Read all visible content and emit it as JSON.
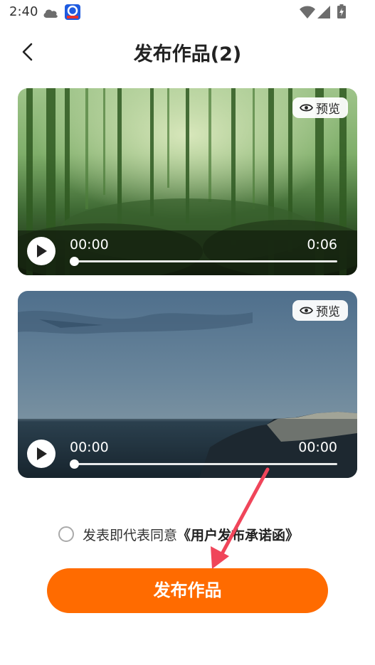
{
  "status_bar": {
    "time": "2:40",
    "icons": [
      "cloud-icon",
      "app-badge-icon",
      "wifi-icon",
      "signal-icon",
      "battery-icon"
    ]
  },
  "header": {
    "title": "发布作品(2)",
    "back_icon": "chevron-left-icon"
  },
  "videos": [
    {
      "preview_label": "预览",
      "preview_icon": "eye-icon",
      "current_time": "00:00",
      "duration": "0:06",
      "progress": 0,
      "scene": "bamboo-forest"
    },
    {
      "preview_label": "预览",
      "preview_icon": "eye-icon",
      "current_time": "00:00",
      "duration": "00:00",
      "progress": 0,
      "scene": "sea-cliffs-dusk"
    }
  ],
  "agreement": {
    "checked": false,
    "text": "发表即代表同意",
    "link": "《用户发布承诺函》"
  },
  "publish_button": {
    "label": "发布作品"
  },
  "colors": {
    "accent": "#ff6b00",
    "annotation_arrow": "#f0455a"
  }
}
